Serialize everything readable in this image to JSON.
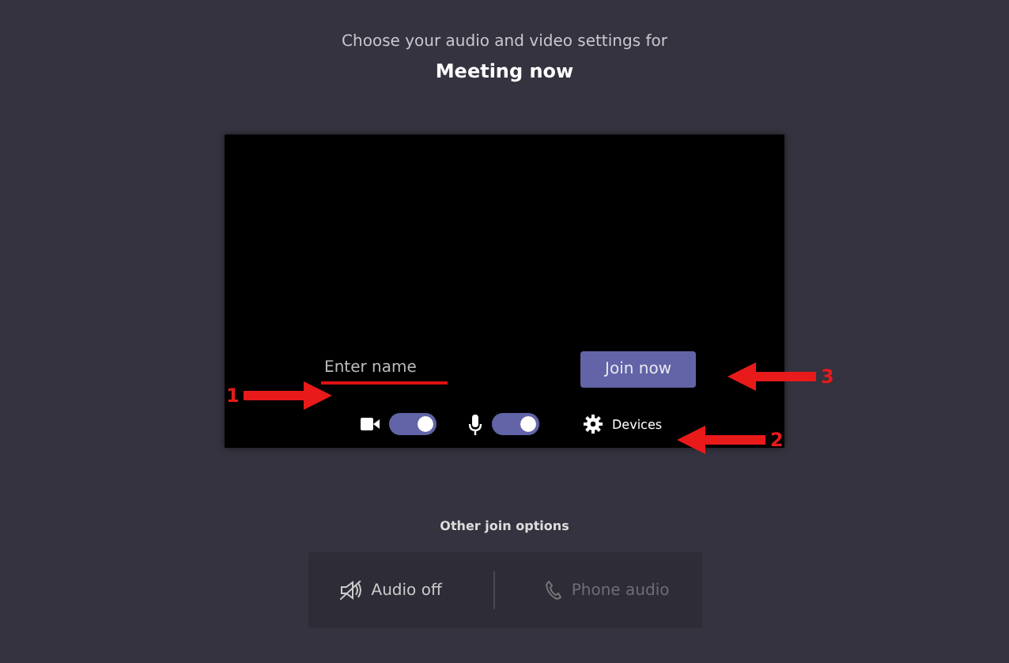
{
  "header": {
    "subtitle": "Choose your audio and video settings for",
    "title": "Meeting now"
  },
  "preview": {
    "name_field": {
      "placeholder": "Enter name"
    },
    "join_button": "Join now",
    "toggles": [
      {
        "kind": "camera",
        "on": true
      },
      {
        "kind": "mic",
        "on": true
      }
    ],
    "devices": "Devices"
  },
  "other_options": {
    "title": "Other join options",
    "options": [
      {
        "kind": "audio-off",
        "label": "Audio off",
        "disabled": false
      },
      {
        "kind": "phone",
        "label": "Phone audio",
        "disabled": true
      }
    ]
  },
  "annotations": [
    {
      "label": "1",
      "kind": "right"
    },
    {
      "label": "2",
      "kind": "left"
    },
    {
      "label": "3",
      "kind": "left"
    }
  ]
}
